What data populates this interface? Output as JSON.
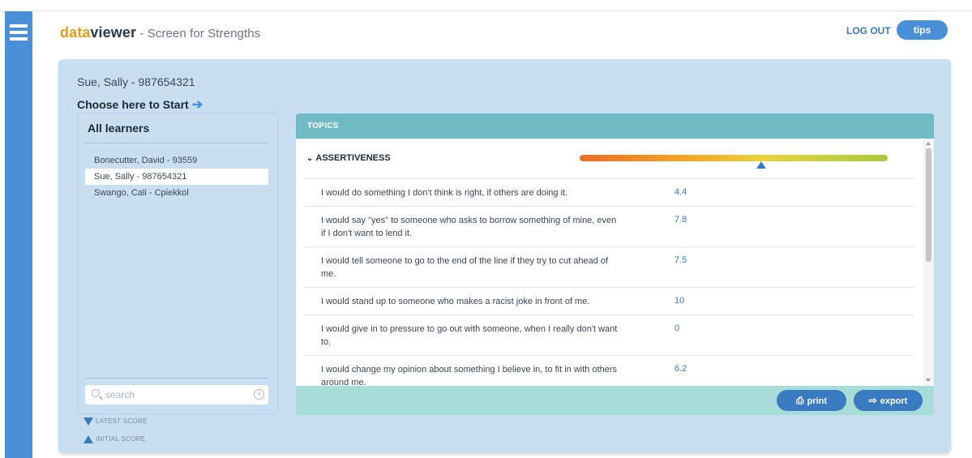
{
  "app": {
    "brand_part1": "data",
    "brand_part2": "viewer",
    "subtitle": " - Screen for Strengths",
    "logout_label": "LOG OUT",
    "tips_label": "tips"
  },
  "learner_header": {
    "current": "Sue, Sally - 987654321",
    "choose_label": "Choose here to Start"
  },
  "learners": {
    "title": "All learners",
    "items": [
      {
        "label": "Bonecutter, David - 93559",
        "selected": false
      },
      {
        "label": "Sue, Sally - 987654321",
        "selected": true
      },
      {
        "label": "Swango, Cali - Cpiekkol",
        "selected": false
      }
    ],
    "search_placeholder": "search"
  },
  "legend": {
    "latest": "LATEST SCORE",
    "initial": "INITIAL SCORE"
  },
  "topics": {
    "header": "TOPICS",
    "section_title": "ASSERTIVENESS",
    "gauge_initial_fraction": 0.59,
    "questions": [
      {
        "text": "I would do something I don't think is right, if others are doing it.",
        "score": "4.4"
      },
      {
        "text": "I would say \"yes\" to someone who asks to borrow something of mine, even if I don't want to lend it.",
        "score": "7.8"
      },
      {
        "text": "I would tell someone to go to the end of the line if they try to cut ahead of me.",
        "score": "7.5"
      },
      {
        "text": "I would stand up to someone who makes a racist joke in front of me.",
        "score": "10"
      },
      {
        "text": "I would give in to pressure to go out with someone, when I really don't want to.",
        "score": "0"
      },
      {
        "text": "I would change my opinion about something I believe in, to fit in with others around me.",
        "score": "6.2"
      }
    ],
    "print_label": "print",
    "export_label": "export"
  },
  "colors": {
    "sidebar": "#4a90d9",
    "brand_accent": "#e89a1a",
    "panel_bg": "#c8dff2",
    "topics_header": "#6fbcc4",
    "topics_footer": "#a8dcd8",
    "button": "#3a7ac0"
  },
  "icons": {
    "menu": "hamburger-icon",
    "arrow": "arrow-right-icon",
    "search": "search-icon",
    "clear": "clear-icon",
    "collapse": "chevron-down-icon",
    "print": "printer-icon",
    "export": "export-icon"
  }
}
